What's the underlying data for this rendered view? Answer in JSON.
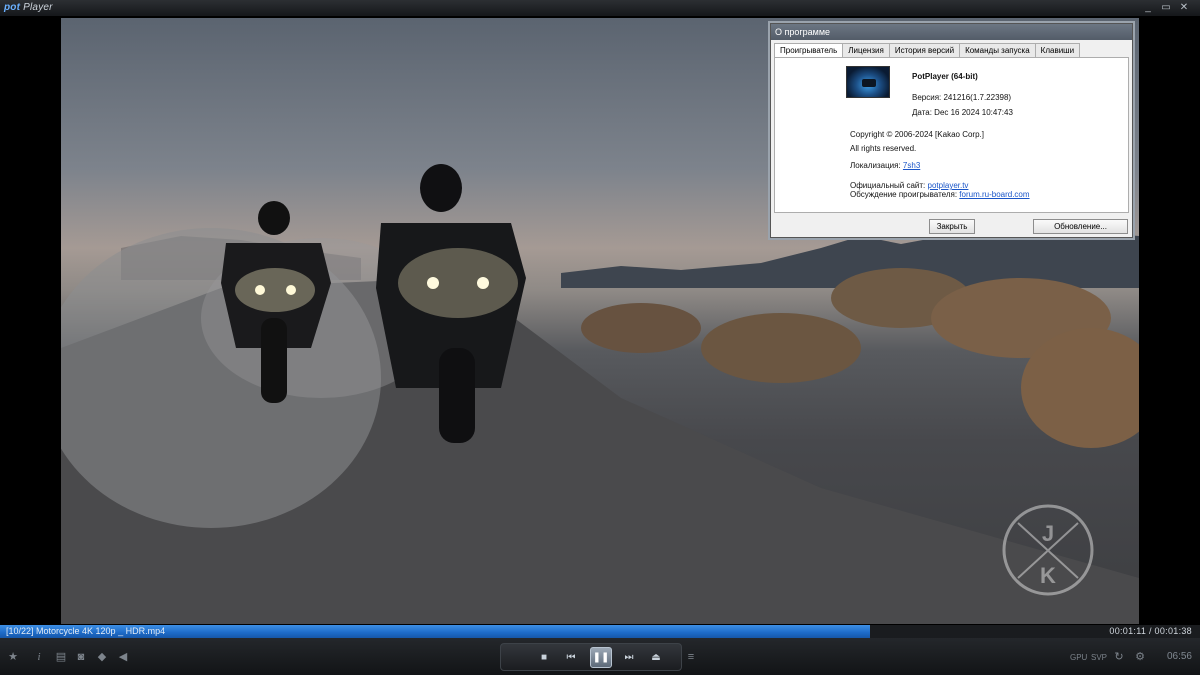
{
  "app": {
    "logo_pre": "pot",
    "logo_post": "Player"
  },
  "window_buttons": [
    "_",
    "▭",
    "✕"
  ],
  "dialog": {
    "title": "О программе",
    "tabs": [
      "Проигрыватель",
      "Лицензия",
      "История версий",
      "Команды запуска",
      "Клавиши"
    ],
    "active_tab": 0,
    "product": "PotPlayer (64-bit)",
    "version": "Версия: 241216(1.7.22398)",
    "date": "Дата: Dec 16 2024 10:47:43",
    "copyright": "Copyright © 2006-2024 [Kakao Corp.]",
    "rights": "All rights reserved.",
    "localization_label": "Локализация:",
    "localization_value": "7sh3",
    "site_label": "Официальный сайт:",
    "site_link": "potplayer.tv",
    "forum_label": "Обсуждение проигрывателя:",
    "forum_link": "forum.ru-board.com",
    "close_button": "Закрыть",
    "update_button": "Обновление..."
  },
  "playback": {
    "now_playing": "[10/22] Motorcycle 4K 120p _ HDR.mp4",
    "time": "00:01:11 / 00:01:38",
    "progress": 0.725
  },
  "controls": {
    "gpu_label": "GPU",
    "svp_label": "SVP",
    "clock": "06:56",
    "play_state_icon": "pause-icon"
  },
  "watermark": {
    "letters": [
      "J",
      "K"
    ]
  },
  "colors": {
    "progress_fill": "#1d6ac7",
    "accent": "#3d8fe4",
    "link": "#1a55c8"
  }
}
